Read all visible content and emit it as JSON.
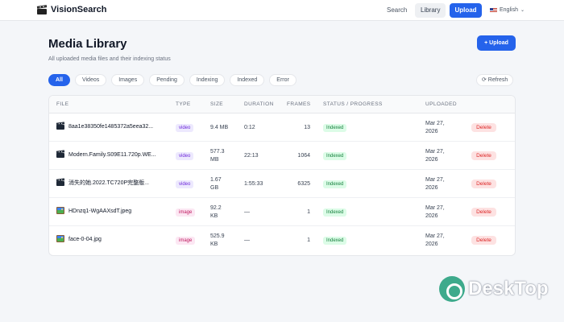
{
  "nav": {
    "brand": "VisionSearch",
    "search_label": "Search",
    "library_label": "Library",
    "upload_label": "Upload",
    "language_label": "English"
  },
  "header": {
    "title": "Media Library",
    "subtitle": "All uploaded media files and their indexing status",
    "upload_button": "+ Upload"
  },
  "filters": [
    "All",
    "Videos",
    "Images",
    "Pending",
    "Indexing",
    "Indexed",
    "Error"
  ],
  "refresh_label": "⟳ Refresh",
  "table": {
    "columns": [
      "FILE",
      "TYPE",
      "SIZE",
      "DURATION",
      "FRAMES",
      "STATUS / PROGRESS",
      "UPLOADED"
    ],
    "rows": [
      {
        "icon": "clapperboard-icon",
        "file": "8aa1e38350fe1485372a5eea32...",
        "type": "video",
        "size": "9.4 MB",
        "size2": "",
        "duration": "0:12",
        "frames": "13",
        "status": "Indexed",
        "uploaded1": "Mar 27,",
        "uploaded2": "2026",
        "action": "Delete"
      },
      {
        "icon": "clapperboard-icon",
        "file": "Modern.Family.S09E11.720p.WE...",
        "type": "video",
        "size": "577.3",
        "size2": "MB",
        "duration": "22:13",
        "frames": "1064",
        "status": "Indexed",
        "uploaded1": "Mar 27,",
        "uploaded2": "2026",
        "action": "Delete"
      },
      {
        "icon": "clapperboard-icon",
        "file": "消失的她.2022.TC720P完整版...",
        "type": "video",
        "size": "1.67",
        "size2": "GB",
        "duration": "1:55:33",
        "frames": "6325",
        "status": "Indexed",
        "uploaded1": "Mar 27,",
        "uploaded2": "2026",
        "action": "Delete"
      },
      {
        "icon": "image-icon",
        "file": "HDnzq1-WgAAXsdT.jpeg",
        "type": "image",
        "size": "92.2",
        "size2": "KB",
        "duration": "—",
        "frames": "1",
        "status": "Indexed",
        "uploaded1": "Mar 27,",
        "uploaded2": "2026",
        "action": "Delete"
      },
      {
        "icon": "image-icon",
        "file": "face-0-04.jpg",
        "type": "image",
        "size": "525.9",
        "size2": "KB",
        "duration": "—",
        "frames": "1",
        "status": "Indexed",
        "uploaded1": "Mar 27,",
        "uploaded2": "2026",
        "action": "Delete"
      }
    ]
  },
  "watermark": "DeskTop",
  "colors": {
    "accent": "#2563eb",
    "video_badge": "#6d28d9",
    "image_badge": "#be185d",
    "indexed_badge": "#15803d",
    "delete": "#dc2626"
  }
}
